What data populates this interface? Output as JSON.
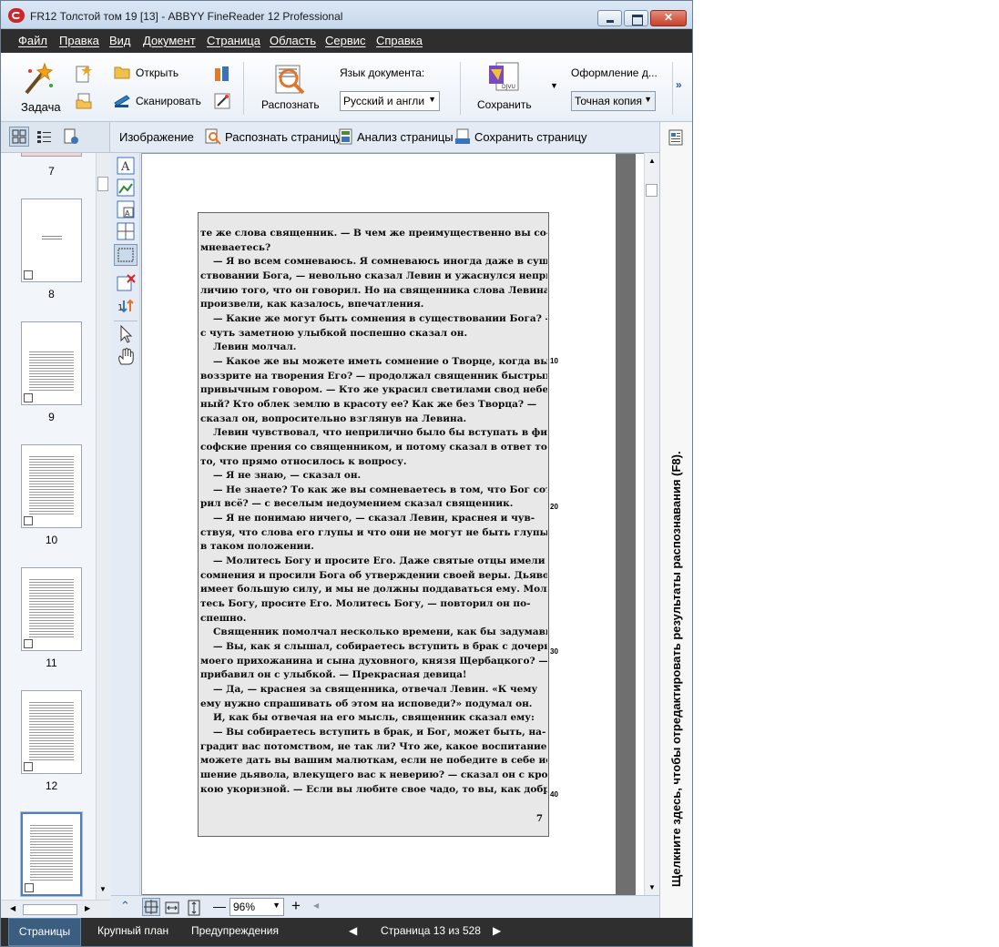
{
  "window": {
    "title": "FR12 Толстой том 19 [13] - ABBYY FineReader 12 Professional"
  },
  "menu": [
    "Файл",
    "Правка",
    "Вид",
    "Документ",
    "Страница",
    "Область",
    "Сервис",
    "Справка"
  ],
  "ribbon": {
    "task_label": "Задача",
    "open_label": "Открыть",
    "scan_label": "Сканировать",
    "recognize_label": "Распознать",
    "doc_language_label": "Язык документа:",
    "doc_language_value": "Русский и англи",
    "save_label": "Сохранить",
    "layout_label": "Оформление д...",
    "layout_value": "Точная копия",
    "more": "»"
  },
  "image_toolbar": {
    "title": "Изображение",
    "recognize_page": "Распознать страницу",
    "analyze_page": "Анализ страницы",
    "save_page": "Сохранить страницу"
  },
  "thumbnails": [
    {
      "num": "7"
    },
    {
      "num": "8"
    },
    {
      "num": "9"
    },
    {
      "num": "10"
    },
    {
      "num": "11"
    },
    {
      "num": "12"
    },
    {
      "num": ""
    }
  ],
  "page": {
    "number": "7",
    "margin_marks": [
      "10",
      "20",
      "30",
      "40"
    ],
    "lines": [
      "те же слова священник. — В чем же преимущественно вы со-",
      "мневаетесь?",
      "— Я во всем сомневаюсь. Я сомневаюсь иногда даже в суще-",
      "ствовании Бога, — невольно сказал Левин и ужаснулся непри-",
      "личию того, что он говорил. Но на священника слова Левина не",
      "произвели, как казалось, впечатления.",
      "— Какие же могут быть сомнения в существовании Бога? —",
      "с чуть заметною улыбкой поспешно сказал он.",
      "Левин молчал.",
      "— Какое же вы можете иметь сомнение о Творце, когда вы",
      "воззрите на творения Его? — продолжал священник быстрым,",
      "привычным говором. — Кто же украсил светилами свод небес-",
      "ный? Кто облек землю в красоту ее? Как же без Творца? —",
      "сказал он, вопросительно взглянув на Левина.",
      "Левин чувствовал, что неприлично было бы вступать в фило-",
      "софские прения со священником, и потому сказал в ответ только",
      "то, что прямо относилось к вопросу.",
      "— Я не знаю, — сказал он.",
      "— Не знаете? То как же вы сомневаетесь в том, что Бог сотво-",
      "рил всё? — с веселым недоумением сказал священник.",
      "— Я не понимаю ничего, — сказал Левин, краснея и чув-",
      "ствуя, что слова его глупы и что они не могут не быть глупы",
      "в таком положении.",
      "— Молитесь Богу и просите Его. Даже святые отцы имели",
      "сомнения и просили Бога об утверждении своей веры. Дьявол",
      "имеет большую силу, и мы не должны поддаваться ему. Моли-",
      "тесь Богу, просите Его. Молитесь Богу, — повторил он по-",
      "спешно.",
      "Священник помолчал несколько времени, как бы задумавшись.",
      "— Вы, как я слышал, собираетесь вступить в брак с дочерью",
      "моего прихожанина и сына духовного, князя Щербацкого? —",
      "прибавил он с улыбкой. — Прекрасная девица!",
      "— Да, — краснея за священника, отвечал Левин. «К чему",
      "ему нужно спрашивать об этом на исповеди?» подумал он.",
      "И, как бы отвечая на его мысль, священник сказал ему:",
      "— Вы собираетесь вступить в брак, и Бог, может быть, на-",
      "градит вас потомством, не так ли? Что же, какое воспитание",
      "можете дать вы вашим малюткам, если не победите в себе иску-",
      "шение дьявола, влекущего вас к неверию? — сказал он с крот-",
      "кою укоризной. — Если вы любите свое чадо, то вы, как добрый"
    ]
  },
  "zoom": {
    "value": "96%"
  },
  "right_panel_text": "Щелкните здесь, чтобы отредактировать результаты распознавания (F8).",
  "status": {
    "tab_pages": "Страницы",
    "tab_closeup": "Крупный план",
    "tab_warnings": "Предупреждения",
    "page_indicator": "Страница 13 из 528"
  }
}
